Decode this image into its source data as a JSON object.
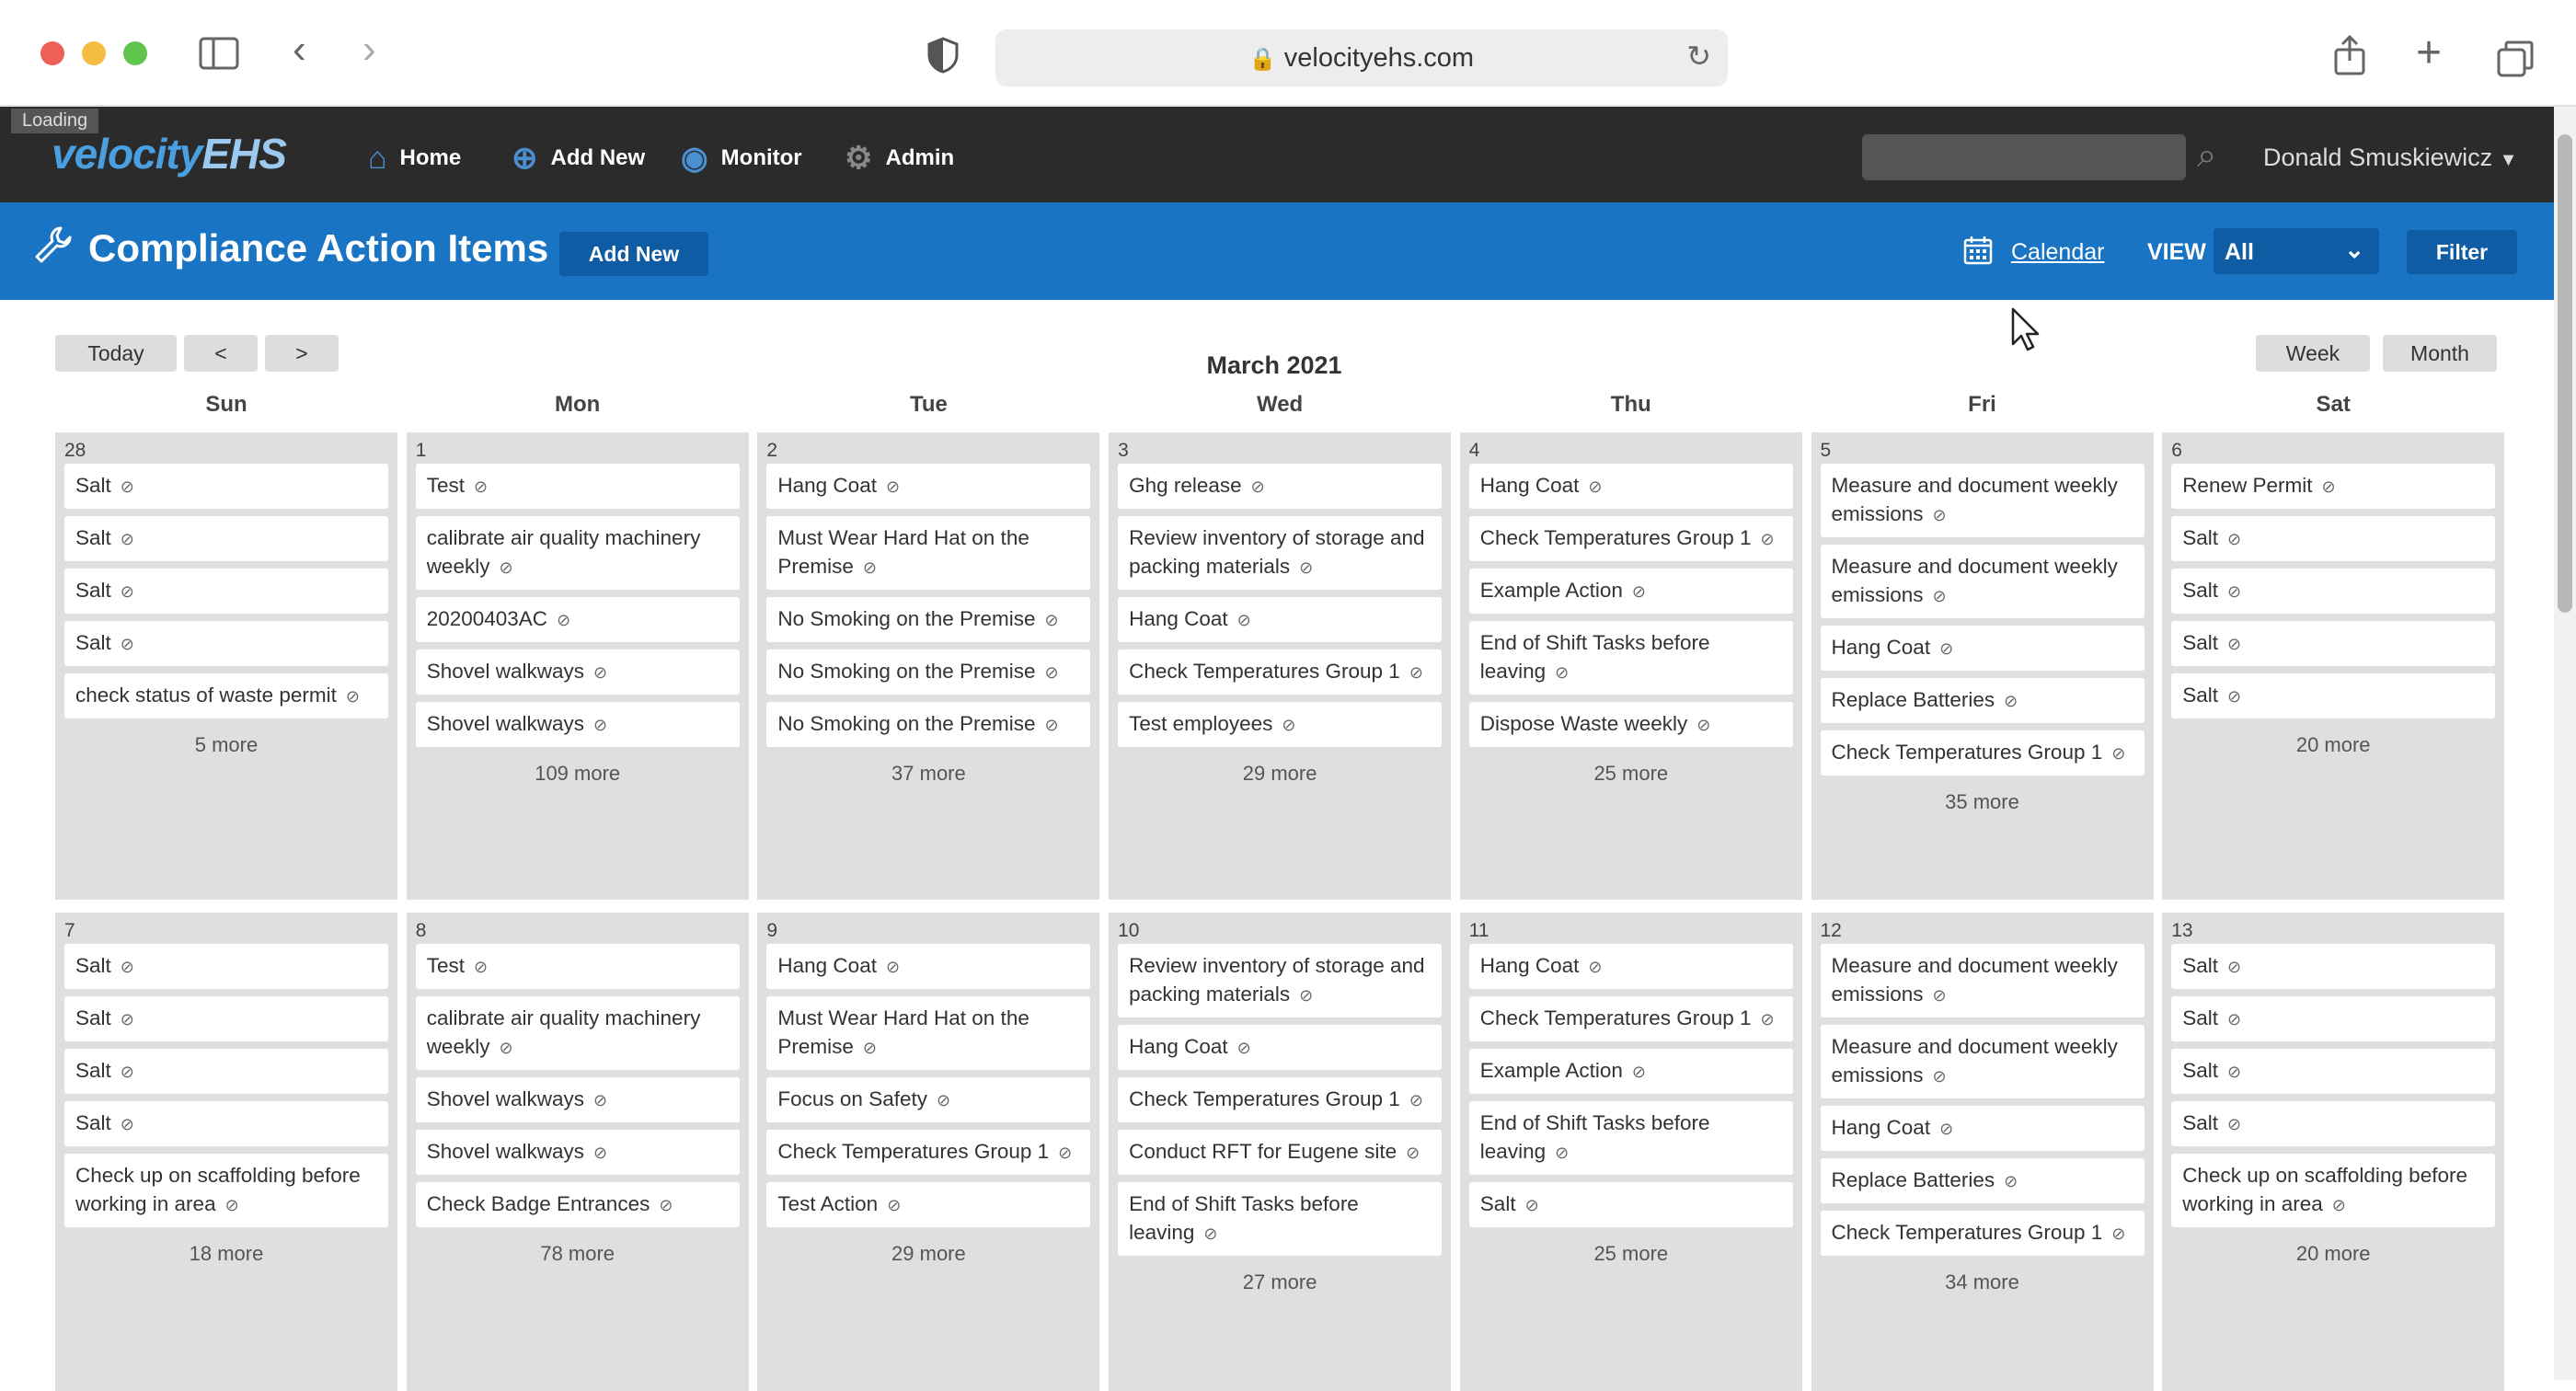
{
  "browser": {
    "url": "velocityehs.com",
    "icons": [
      "sidebar-icon",
      "back-icon",
      "forward-icon",
      "shield-icon",
      "lock-icon",
      "reload-icon",
      "share-icon",
      "new-tab-icon",
      "tabs-icon"
    ]
  },
  "app": {
    "loading": "Loading",
    "logo_main": "velocity",
    "logo_accent": "EHS",
    "nav": [
      {
        "label": "Home",
        "icon": "home-icon"
      },
      {
        "label": "Add New",
        "icon": "plus-circle-icon"
      },
      {
        "label": "Monitor",
        "icon": "eye-icon"
      },
      {
        "label": "Admin",
        "icon": "gear-icon"
      }
    ],
    "search_placeholder": "",
    "user": "Donald Smuskiewicz"
  },
  "header": {
    "title": "Compliance Action Items",
    "add_new": "Add New",
    "calendar": "Calendar",
    "view_label": "VIEW",
    "view_value": "All",
    "filter": "Filter"
  },
  "calendar": {
    "today": "Today",
    "prev": "<",
    "next": ">",
    "week": "Week",
    "month": "Month",
    "title": "March 2021",
    "day_names": [
      "Sun",
      "Mon",
      "Tue",
      "Wed",
      "Thu",
      "Fri",
      "Sat"
    ],
    "weeks": [
      [
        {
          "date": "28",
          "events": [
            "Salt",
            "Salt",
            "Salt",
            "Salt",
            "check status of waste permit"
          ],
          "more": "5 more"
        },
        {
          "date": "1",
          "events": [
            "Test",
            "calibrate air quality machinery weekly",
            "20200403AC",
            "Shovel walkways",
            "Shovel walkways"
          ],
          "more": "109 more"
        },
        {
          "date": "2",
          "events": [
            "Hang Coat",
            "Must Wear Hard Hat on the Premise",
            "No Smoking on the Premise",
            "No Smoking on the Premise",
            "No Smoking on the Premise"
          ],
          "more": "37 more"
        },
        {
          "date": "3",
          "events": [
            "Ghg release",
            "Review inventory of storage and packing materials",
            "Hang Coat",
            "Check Temperatures Group 1",
            "Test employees"
          ],
          "more": "29 more"
        },
        {
          "date": "4",
          "events": [
            "Hang Coat",
            "Check Temperatures Group 1",
            "Example Action",
            "End of Shift Tasks before leaving",
            "Dispose Waste weekly"
          ],
          "more": "25 more"
        },
        {
          "date": "5",
          "events": [
            "Measure and document weekly emissions",
            "Measure and document weekly emissions",
            "Hang Coat",
            "Replace Batteries",
            "Check Temperatures Group 1"
          ],
          "more": "35 more"
        },
        {
          "date": "6",
          "events": [
            "Renew Permit",
            "Salt",
            "Salt",
            "Salt",
            "Salt"
          ],
          "more": "20 more"
        }
      ],
      [
        {
          "date": "7",
          "events": [
            "Salt",
            "Salt",
            "Salt",
            "Salt",
            "Check up on scaffolding before working in area"
          ],
          "more": "18 more"
        },
        {
          "date": "8",
          "events": [
            "Test",
            "calibrate air quality machinery weekly",
            "Shovel walkways",
            "Shovel walkways",
            "Check Badge Entrances"
          ],
          "more": "78 more"
        },
        {
          "date": "9",
          "events": [
            "Hang Coat",
            "Must Wear Hard Hat on the Premise",
            "Focus on Safety",
            "Check Temperatures Group 1",
            "Test Action"
          ],
          "more": "29 more"
        },
        {
          "date": "10",
          "events": [
            "Review inventory of storage and packing materials",
            "Hang Coat",
            "Check Temperatures Group 1",
            "Conduct RFT for Eugene site",
            "End of Shift Tasks before leaving"
          ],
          "more": "27 more"
        },
        {
          "date": "11",
          "events": [
            "Hang Coat",
            "Check Temperatures Group 1",
            "Example Action",
            "End of Shift Tasks before leaving",
            "Salt"
          ],
          "more": "25 more"
        },
        {
          "date": "12",
          "events": [
            "Measure and document weekly emissions",
            "Measure and document weekly emissions",
            "Hang Coat",
            "Replace Batteries",
            "Check Temperatures Group 1"
          ],
          "more": "34 more"
        },
        {
          "date": "13",
          "events": [
            "Salt",
            "Salt",
            "Salt",
            "Salt",
            "Check up on scaffolding before working in area"
          ],
          "more": "20 more"
        }
      ]
    ]
  },
  "colors": {
    "nav_bg": "#2b2b2b",
    "header_blue": "#1a74c4",
    "cell_gray": "#dfdfdf"
  }
}
